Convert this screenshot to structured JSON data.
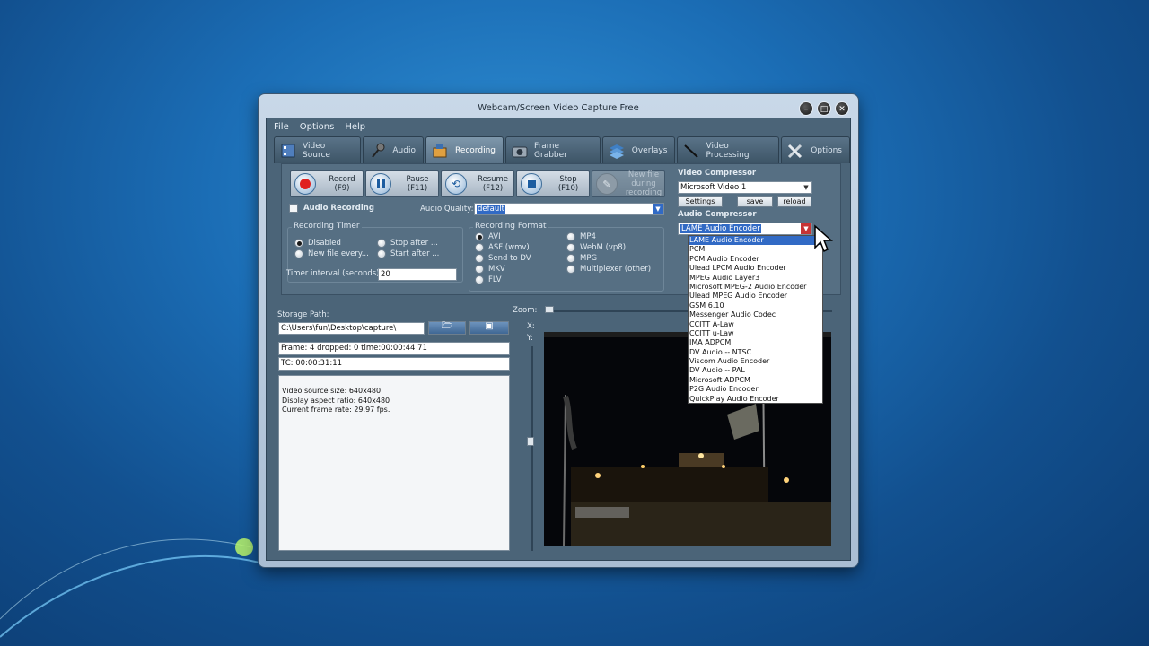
{
  "window": {
    "title": "Webcam/Screen Video Capture Free"
  },
  "titlebar_buttons": [
    "minimize-icon",
    "maximize-icon",
    "close-icon"
  ],
  "menu": [
    "File",
    "Options",
    "Help"
  ],
  "tabs": [
    {
      "label": "Video Source",
      "icon": "film-icon"
    },
    {
      "label": "Audio",
      "icon": "microphone-icon"
    },
    {
      "label": "Recording",
      "icon": "recorder-icon",
      "active": true
    },
    {
      "label": "Frame Grabber",
      "icon": "camera-icon"
    },
    {
      "label": "Overlays",
      "icon": "layers-icon"
    },
    {
      "label": "Video Processing",
      "icon": "wand-icon"
    },
    {
      "label": "Options",
      "icon": "tools-icon"
    }
  ],
  "controls": {
    "record": {
      "line1": "Record",
      "line2": "(F9)"
    },
    "pause": {
      "line1": "Pause",
      "line2": "(F11)"
    },
    "resume": {
      "line1": "Resume",
      "line2": "(F12)"
    },
    "stop": {
      "line1": "Stop",
      "line2": "(F10)"
    },
    "new_file": {
      "line1": "New file during",
      "line2": "recording"
    }
  },
  "audio_recording": {
    "label": "Audio Recording",
    "quality_label": "Audio Quality:",
    "quality_value": "default"
  },
  "recording_timer": {
    "title": "Recording Timer",
    "options": [
      "Disabled",
      "Stop after ...",
      "New file every...",
      "Start after ..."
    ],
    "interval_label": "Timer interval (seconds) :",
    "interval_value": "20"
  },
  "recording_format": {
    "title": "Recording Format",
    "options_left": [
      "AVI",
      "ASF (wmv)",
      "Send to DV",
      "MKV",
      "FLV"
    ],
    "options_right": [
      "MP4",
      "WebM (vp8)",
      "MPG",
      "Multiplexer (other)"
    ]
  },
  "video_compressor": {
    "label": "Video Compressor",
    "value": "Microsoft Video 1",
    "settings": "Settings",
    "save": "save",
    "reload": "reload"
  },
  "audio_compressor": {
    "label": "Audio Compressor",
    "value": "LAME Audio Encoder",
    "options": [
      "LAME Audio Encoder",
      "PCM",
      "PCM Audio Encoder",
      "Ulead LPCM Audio Encoder",
      "MPEG Audio Layer3",
      "Microsoft MPEG-2 Audio Encoder",
      "Ulead MPEG Audio Encoder",
      "GSM 6.10",
      "Messenger Audio Codec",
      "CCITT A-Law",
      "CCITT u-Law",
      "IMA ADPCM",
      "DV Audio -- NTSC",
      "Viscom Audio Encoder",
      "DV Audio -- PAL",
      "Microsoft ADPCM",
      "P2G Audio Encoder",
      "QuickPlay Audio Encoder"
    ]
  },
  "storage": {
    "label": "Storage Path:",
    "path": "C:\\Users\\fun\\Desktop\\capture\\",
    "frame_status": "Frame: 4 dropped: 0 time:00:00:44 71",
    "tc": "TC: 00:00:31:11",
    "info": [
      "Video source size: 640x480",
      "Display aspect ratio: 640x480",
      "Current frame rate: 29.97 fps."
    ]
  },
  "preview": {
    "zoom_label": "Zoom:",
    "x_label": "X:",
    "y_label": "Y:"
  },
  "colors": {
    "panel": "#566f83",
    "client": "#4b6478",
    "selection": "#316ac5",
    "record_red": "#e02020"
  }
}
